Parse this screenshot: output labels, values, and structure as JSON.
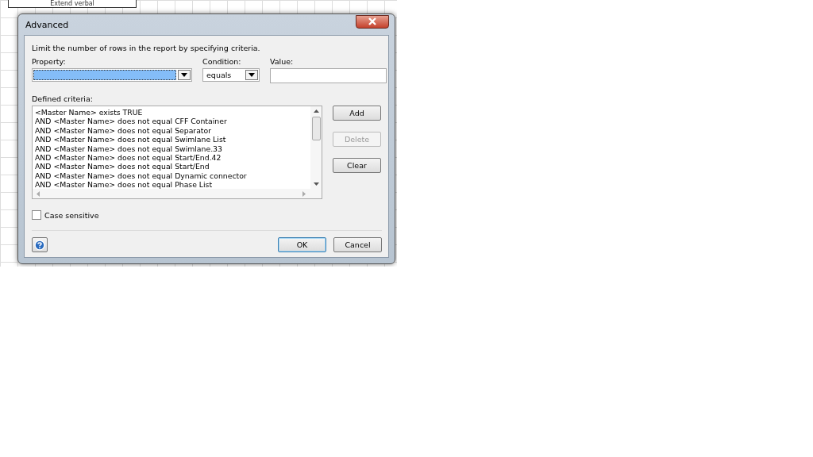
{
  "background": {
    "shape_label": "Extend verbal"
  },
  "window": {
    "title": "Advanced"
  },
  "instruction": "Limit the number of rows in the report by specifying criteria.",
  "property": {
    "label": "Property:",
    "focused": true
  },
  "condition": {
    "label": "Condition:",
    "value": "equals"
  },
  "value_field": {
    "label": "Value:"
  },
  "criteria": {
    "label": "Defined criteria:",
    "items": [
      "<Master Name> exists TRUE",
      "AND <Master Name> does not equal CFF Container",
      "AND <Master Name> does not equal Separator",
      "AND <Master Name> does not equal Swimlane List",
      "AND <Master Name> does not equal Swimlane.33",
      "AND <Master Name> does not equal Start/End.42",
      "AND <Master Name> does not equal Start/End",
      "AND <Master Name> does not equal Dynamic connector",
      "AND <Master Name> does not equal Phase List"
    ]
  },
  "side_buttons": [
    {
      "label": "Add",
      "disabled": false
    },
    {
      "label": "Delete",
      "disabled": true
    },
    {
      "label": "Clear",
      "disabled": false
    }
  ],
  "case_sensitive": {
    "label": "Case sensitive",
    "checked": false
  },
  "buttons": [
    {
      "label": "OK",
      "default": true
    },
    {
      "label": "Cancel",
      "default": false
    }
  ]
}
